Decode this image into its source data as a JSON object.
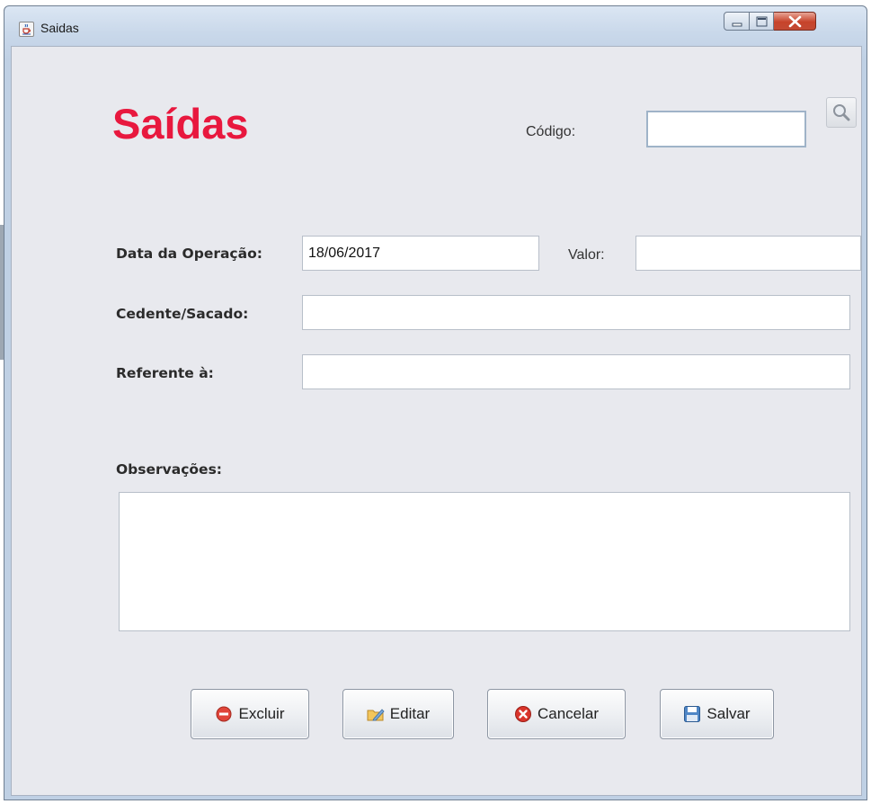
{
  "window": {
    "title": "Saidas",
    "icon": "java-cup-icon",
    "controls": [
      "minimize-icon",
      "maximize-icon",
      "close-icon"
    ]
  },
  "form": {
    "heading": "Saídas",
    "heading_color": "#e8183e",
    "codigo_label": "Código:",
    "codigo_value": "",
    "search_icon": "search-icon",
    "data_label": "Data da Operação:",
    "data_value": "18/06/2017",
    "valor_label": "Valor:",
    "valor_value": "",
    "cedente_label": "Cedente/Sacado:",
    "cedente_value": "",
    "referente_label": "Referente à:",
    "referente_value": "",
    "observacoes_label": "Observações:",
    "observacoes_value": ""
  },
  "buttons": {
    "excluir": {
      "label": "Excluir",
      "icon": "delete-icon"
    },
    "editar": {
      "label": "Editar",
      "icon": "edit-folder-icon"
    },
    "cancelar": {
      "label": "Cancelar",
      "icon": "cancel-icon"
    },
    "salvar": {
      "label": "Salvar",
      "icon": "save-disk-icon"
    }
  }
}
